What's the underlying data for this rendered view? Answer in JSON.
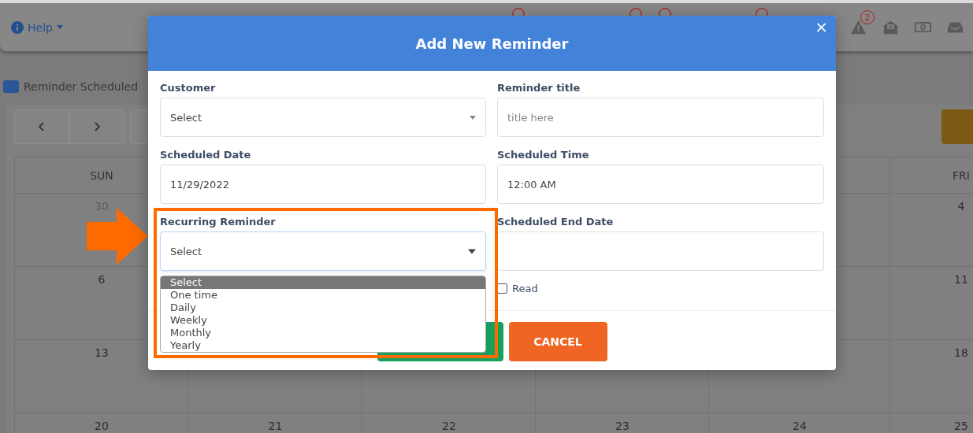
{
  "top_bar": {
    "help_label": "Help",
    "alert_badge": "2"
  },
  "legend": {
    "label": "Reminder Scheduled",
    "color": "#2b569a"
  },
  "calendar": {
    "headers": {
      "sun": "SUN",
      "fri": "FRI"
    },
    "weeks": [
      {
        "sun": {
          "day": "30",
          "muted": true
        },
        "fri": {
          "day": "4",
          "muted": false
        }
      },
      {
        "sun": {
          "day": "6",
          "muted": false
        },
        "fri": {
          "day": "11",
          "muted": false
        }
      },
      {
        "sun": {
          "day": "13",
          "muted": false
        },
        "fri": {
          "day": "18",
          "muted": false
        }
      },
      {
        "sun": {
          "day": "20",
          "muted": false
        },
        "mon": {
          "day": "21",
          "muted": false
        },
        "tue": {
          "day": "22",
          "muted": false
        },
        "wed": {
          "day": "23",
          "muted": false
        },
        "thu": {
          "day": "24",
          "muted": false
        },
        "fri": {
          "day": "25",
          "muted": false
        }
      }
    ]
  },
  "modal": {
    "title": "Add New Reminder",
    "close": "×",
    "fields": [
      {
        "label": "Customer",
        "kind": "select",
        "value": "Select"
      },
      {
        "label": "Reminder title",
        "kind": "text",
        "placeholder": "title here"
      },
      {
        "label": "Scheduled Date",
        "kind": "text",
        "value": "11/29/2022"
      },
      {
        "label": "Scheduled Time",
        "kind": "text",
        "value": "12:00 AM"
      },
      {
        "label": "Recurring Reminder",
        "kind": "select",
        "value": "Select",
        "expanded": true,
        "options": [
          {
            "label": "Select",
            "selected": true
          },
          {
            "label": "One time",
            "selected": false
          },
          {
            "label": "Daily",
            "selected": false
          },
          {
            "label": "Weekly",
            "selected": false
          },
          {
            "label": "Monthly",
            "selected": false
          },
          {
            "label": "Yearly",
            "selected": false
          }
        ]
      },
      {
        "label": "Scheduled End Date",
        "kind": "text"
      }
    ],
    "read_checkbox": {
      "label": "Read",
      "checked": false
    },
    "buttons": [
      {
        "kind": "submit"
      },
      {
        "kind": "cancel",
        "label": "CANCEL"
      }
    ]
  }
}
